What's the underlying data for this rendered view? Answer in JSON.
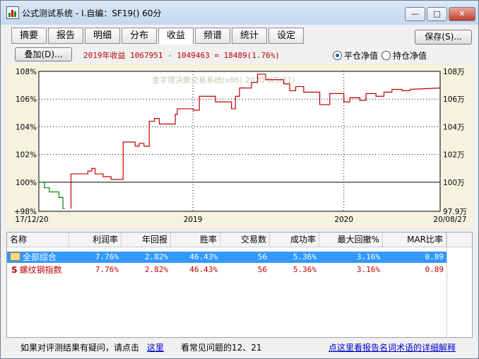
{
  "window": {
    "title": "公式测试系统 - I.自编：SF19() 60分"
  },
  "tabs": [
    "摘要",
    "报告",
    "明细",
    "分布",
    "收益",
    "频谱",
    "统计",
    "设定"
  ],
  "active_tab": 4,
  "buttons": {
    "save": "保存(S)...",
    "overlay": "叠加(D)..."
  },
  "summary_text": "2019年收益 1067951 - 1049463 = 18489(1.76%)",
  "radios": [
    {
      "label": "平仓净值",
      "checked": true
    },
    {
      "label": "持仓净值",
      "checked": false
    }
  ],
  "chart_data": {
    "type": "line",
    "watermark": "金字塔决策交易系统(x86) 2020  0/5/31)",
    "left_axis_labels": [
      "108%",
      "106%",
      "104%",
      "102%",
      "100%",
      "+98%"
    ],
    "right_axis_labels": [
      "108万",
      "106万",
      "104万",
      "102万",
      "100万",
      "97.9万"
    ],
    "x_tick_labels": [
      "17/12/20",
      "2019",
      "2020",
      "20/08/27"
    ],
    "ylim": [
      97.9,
      108
    ],
    "x_range": [
      0,
      1000
    ],
    "baseline": 100,
    "series": [
      {
        "color": "#008000",
        "x": [
          0,
          14,
          14,
          26,
          26,
          50,
          50,
          60,
          60,
          65
        ],
        "y": [
          100,
          100,
          99.6,
          99.6,
          99.3,
          99.3,
          98.9,
          98.9,
          98.1,
          98.1
        ]
      },
      {
        "color": "#c00000",
        "x": [
          80,
          80,
          122,
          122,
          132,
          132,
          140,
          140,
          160,
          160,
          180,
          180,
          210,
          210,
          240,
          240,
          250,
          250,
          262,
          262,
          275,
          275,
          288,
          288,
          300,
          300,
          340,
          340,
          345,
          345,
          385,
          385,
          400,
          400,
          440,
          440,
          480,
          480,
          490,
          490,
          500,
          500,
          530,
          530,
          545,
          545,
          565,
          565,
          610,
          610,
          625,
          625,
          640,
          640,
          660,
          660,
          700,
          700,
          725,
          725,
          760,
          760,
          775,
          775,
          800,
          800,
          815,
          815,
          840,
          840,
          860,
          860,
          880,
          880,
          905,
          905,
          925,
          925,
          1000
        ],
        "y": [
          98.1,
          100.6,
          100.6,
          100.8,
          100.8,
          101,
          101,
          100.6,
          100.6,
          100.4,
          100.4,
          100.2,
          100.2,
          102.9,
          102.9,
          102.6,
          102.6,
          102.8,
          102.8,
          102.6,
          102.6,
          104.4,
          104.4,
          104.6,
          104.6,
          104.2,
          104.2,
          104.9,
          104.9,
          105.3,
          105.3,
          105.2,
          105.2,
          106.2,
          106.2,
          105.8,
          105.8,
          105.3,
          105.3,
          106.2,
          106.2,
          106.8,
          106.8,
          107.2,
          107.2,
          107.8,
          107.8,
          107.4,
          107.4,
          107.1,
          107.1,
          106.6,
          106.6,
          106.9,
          106.9,
          106.5,
          106.5,
          105.6,
          105.6,
          106.4,
          106.4,
          105.8,
          105.8,
          106.1,
          106.1,
          105.9,
          105.9,
          106.4,
          106.4,
          106.2,
          106.2,
          106.5,
          106.5,
          106.7,
          106.7,
          106.6,
          106.6,
          106.7,
          106.8
        ]
      }
    ]
  },
  "table": {
    "columns": [
      "名称",
      "利润率",
      "年回报",
      "胜率",
      "交易数",
      "成功率",
      "最大回撤%",
      "MAR比率"
    ],
    "rows": [
      [
        "全部综合",
        "7.76%",
        "2.82%",
        "46.43%",
        "56",
        "5.36%",
        "3.16%",
        "0.89"
      ],
      [
        "螺纹钢指数",
        "7.76%",
        "2.82%",
        "46.43%",
        "56",
        "5.36%",
        "3.16%",
        "0.89"
      ]
    ]
  },
  "status": {
    "text1": "如果对评测结果有疑问，请点击",
    "link1": "这里",
    "text2": "看常见问题的12、21",
    "link2": "点这里看报告名词术语的详细解释"
  },
  "icons": {
    "window": "chart-app-icon",
    "folder": "folder-icon"
  }
}
